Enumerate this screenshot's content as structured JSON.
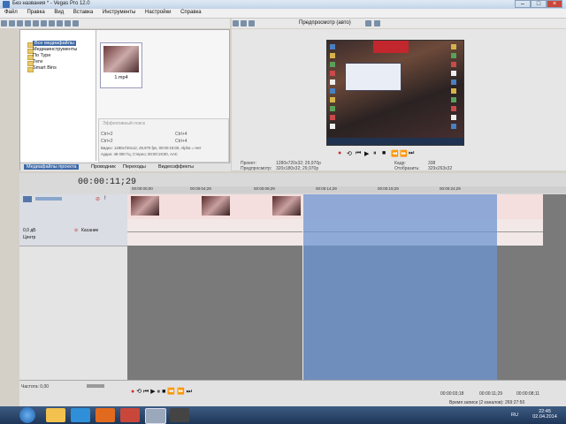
{
  "window": {
    "title": "Без названия * - Vegas Pro 12.0"
  },
  "menu": [
    "Файл",
    "Правка",
    "Вид",
    "Вставка",
    "Инструменты",
    "Настройки",
    "Справка"
  ],
  "media_panel": {
    "tree": [
      "Все медиафайлы",
      "Медиаинструменты",
      "По Туре",
      "Теги",
      "Smart Bins"
    ],
    "thumb_caption": "1.mp4",
    "search_placeholder": "Эффективный поиск",
    "props": {
      "a1": "Ctrl+2",
      "a2": "Ctrl+4",
      "b1": "Ctrl+2",
      "b2": "Ctrl+4",
      "video_line": "Видео: 1280x720x12, 29,970 fps, 00:00:19;00, Alpha = Нет",
      "audio_line": "Аудио: 48 000 Гц; Стерео; 00:00:19;00, AAC"
    },
    "tabs": [
      "Медиафайлы проекта",
      "Проводник",
      "Переходы",
      "Видеоэффекты"
    ]
  },
  "preview": {
    "mode_label": "Предпросмотр (авто)",
    "info": {
      "project_label": "Проект:",
      "project": "1280x720x32; 29,970p",
      "preview_label": "Предпросмотр:",
      "preview": "320x180x32; 29,970p",
      "frame_label": "Кадр:",
      "frame": "338",
      "display_label": "Отобразить:",
      "display": "329x263x32"
    }
  },
  "timeline": {
    "timecode": "00:00:11;29",
    "ruler": [
      "00:00:00;00",
      "00:00:04;29",
      "00:00:09;29",
      "00:00:14;29",
      "00:00:19;29",
      "00:00:24;29"
    ],
    "audio_track": {
      "volume_label": "0,0 дБ",
      "pan_label": "Центр",
      "mode_label": "Касание"
    }
  },
  "footer": {
    "rate_label": "Частота: 0,00",
    "pos": "00:00:03;18",
    "pos2": "00:00:11;29",
    "pos3": "00:00:08;11",
    "record_time": "Время записи (2 каналов): 269:27:50"
  },
  "taskbar": {
    "lang": "RU",
    "time": "22:45",
    "date": "02.04.2014"
  },
  "colors": {
    "selection": "#6e96d2",
    "video_track": "#f4dede",
    "taskbar": "#1e3658"
  }
}
